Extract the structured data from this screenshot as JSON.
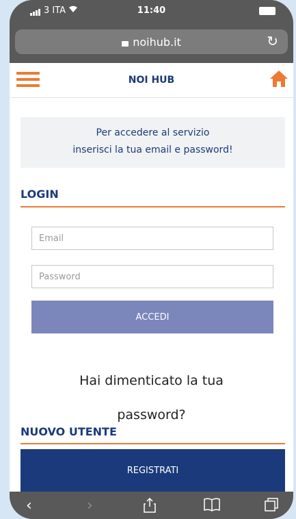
{
  "status": {
    "carrier": "3 ITA",
    "time": "11:40"
  },
  "browser": {
    "domain": "noihub.it",
    "reload_icon": "reload-icon"
  },
  "header": {
    "title": "NOI HUB",
    "menu_icon": "hamburger-menu-icon",
    "home_icon": "home-icon"
  },
  "info": {
    "line1": "Per accedere al servizio",
    "line2": "inserisci la tua email e password!"
  },
  "login": {
    "title": "LOGIN",
    "email_placeholder": "Email",
    "password_placeholder": "Password",
    "submit_label": "ACCEDI",
    "forgot_line1": "Hai dimenticato la tua",
    "forgot_line2": "password?"
  },
  "new_user": {
    "title": "NUOVO UTENTE",
    "register_label": "REGISTRATI"
  },
  "colors": {
    "accent": "#ec7a31",
    "brand": "#1b3a7b",
    "button_muted": "#7b86bb"
  }
}
